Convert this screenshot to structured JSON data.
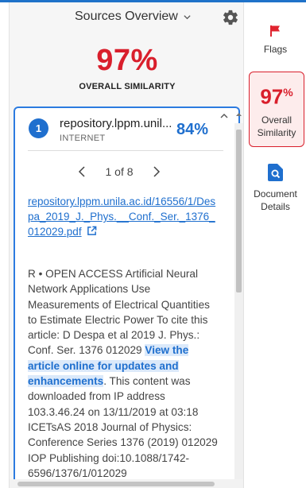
{
  "header": {
    "title": "Sources Overview"
  },
  "summary": {
    "score": "97%",
    "label": "OVERALL SIMILARITY"
  },
  "source_card": {
    "number": "1",
    "name": "repository.lppm.unil...",
    "type": "INTERNET",
    "percent": "84%",
    "pager": "1 of 8",
    "url": "repository.lppm.unila.ac.id/16556/1/Despa_2019_J._Phys.__Conf._Ser._1376_012029.pdf",
    "text_before": "R • OPEN ACCESS Artificial Neural Network Applications Use Measurements of Electrical Quantities to Estimate Electric Power To cite this article: D Despa et al 2019 J. Phys.: Conf. Ser. 1376 012029 ",
    "text_highlight": "View the article online for updates and enhancements",
    "text_after": ". This content was downloaded from IP address 103.3.46.24 on 13/11/2019 at 03:18 ICETsAS 2018 Journal of Physics: Conference Series 1376 (2019) 012029 IOP Publishing doi:10.1088/1742-6596/1376/1/012029"
  },
  "rail": {
    "flags_label": "Flags",
    "similarity_value": "97",
    "similarity_unit": "%",
    "similarity_label": "Overall Similarity",
    "details_label": "Document Details"
  },
  "colors": {
    "accent": "#1f6fce",
    "score_red": "#d91f2c",
    "highlight_bg": "#dbe9fa"
  }
}
